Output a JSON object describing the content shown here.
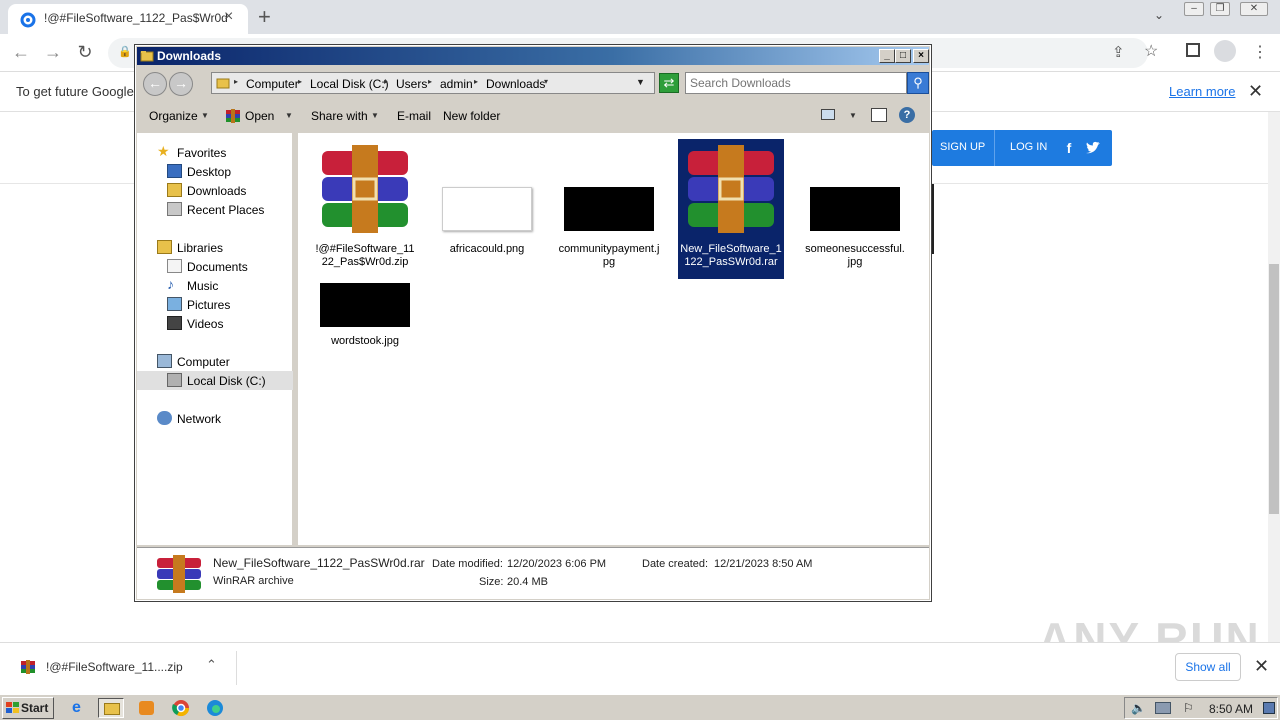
{
  "browser": {
    "tab_title": "!@#FileSoftware_1122_Pas$Wr0d",
    "infobar_message": "To get future Google",
    "learn_more": "Learn more",
    "site_signup": "SIGN UP",
    "site_login": "LOG IN",
    "site_facebook": "f"
  },
  "explorer": {
    "title": "Downloads",
    "breadcrumb": [
      "Computer",
      "Local Disk (C:)",
      "Users",
      "admin",
      "Downloads"
    ],
    "search_placeholder": "Search Downloads",
    "commands": {
      "organize": "Organize",
      "open": "Open",
      "share_with": "Share with",
      "email": "E-mail",
      "new_folder": "New folder"
    },
    "nav": {
      "favorites": "Favorites",
      "desktop": "Desktop",
      "downloads": "Downloads",
      "recent_places": "Recent Places",
      "libraries": "Libraries",
      "documents": "Documents",
      "music": "Music",
      "pictures": "Pictures",
      "videos": "Videos",
      "computer": "Computer",
      "local_disk": "Local Disk (C:)",
      "network": "Network"
    },
    "files": [
      {
        "name": "!@#FileSoftware_1122_Pas$Wr0d.zip",
        "type": "winrar"
      },
      {
        "name": "africacould.png",
        "type": "white-image"
      },
      {
        "name": "communitypayment.jpg",
        "type": "black-image"
      },
      {
        "name": "New_FileSoftware_1122_PasSWr0d.rar",
        "type": "winrar",
        "selected": true
      },
      {
        "name": "someonesuccessful.jpg",
        "type": "black-image"
      },
      {
        "name": "wordstook.jpg",
        "type": "black-image"
      }
    ],
    "details": {
      "filename": "New_FileSoftware_1122_PasSWr0d.rar",
      "filetype": "WinRAR archive",
      "date_modified_label": "Date modified:",
      "date_modified": "12/20/2023 6:06 PM",
      "size_label": "Size:",
      "size": "20.4 MB",
      "date_created_label": "Date created:",
      "date_created": "12/21/2023 8:50 AM"
    }
  },
  "shelf": {
    "download_name": "!@#FileSoftware_11....zip",
    "show_all": "Show all"
  },
  "watermark": "ANY RUN",
  "taskbar": {
    "start": "Start",
    "clock": "8:50 AM"
  }
}
